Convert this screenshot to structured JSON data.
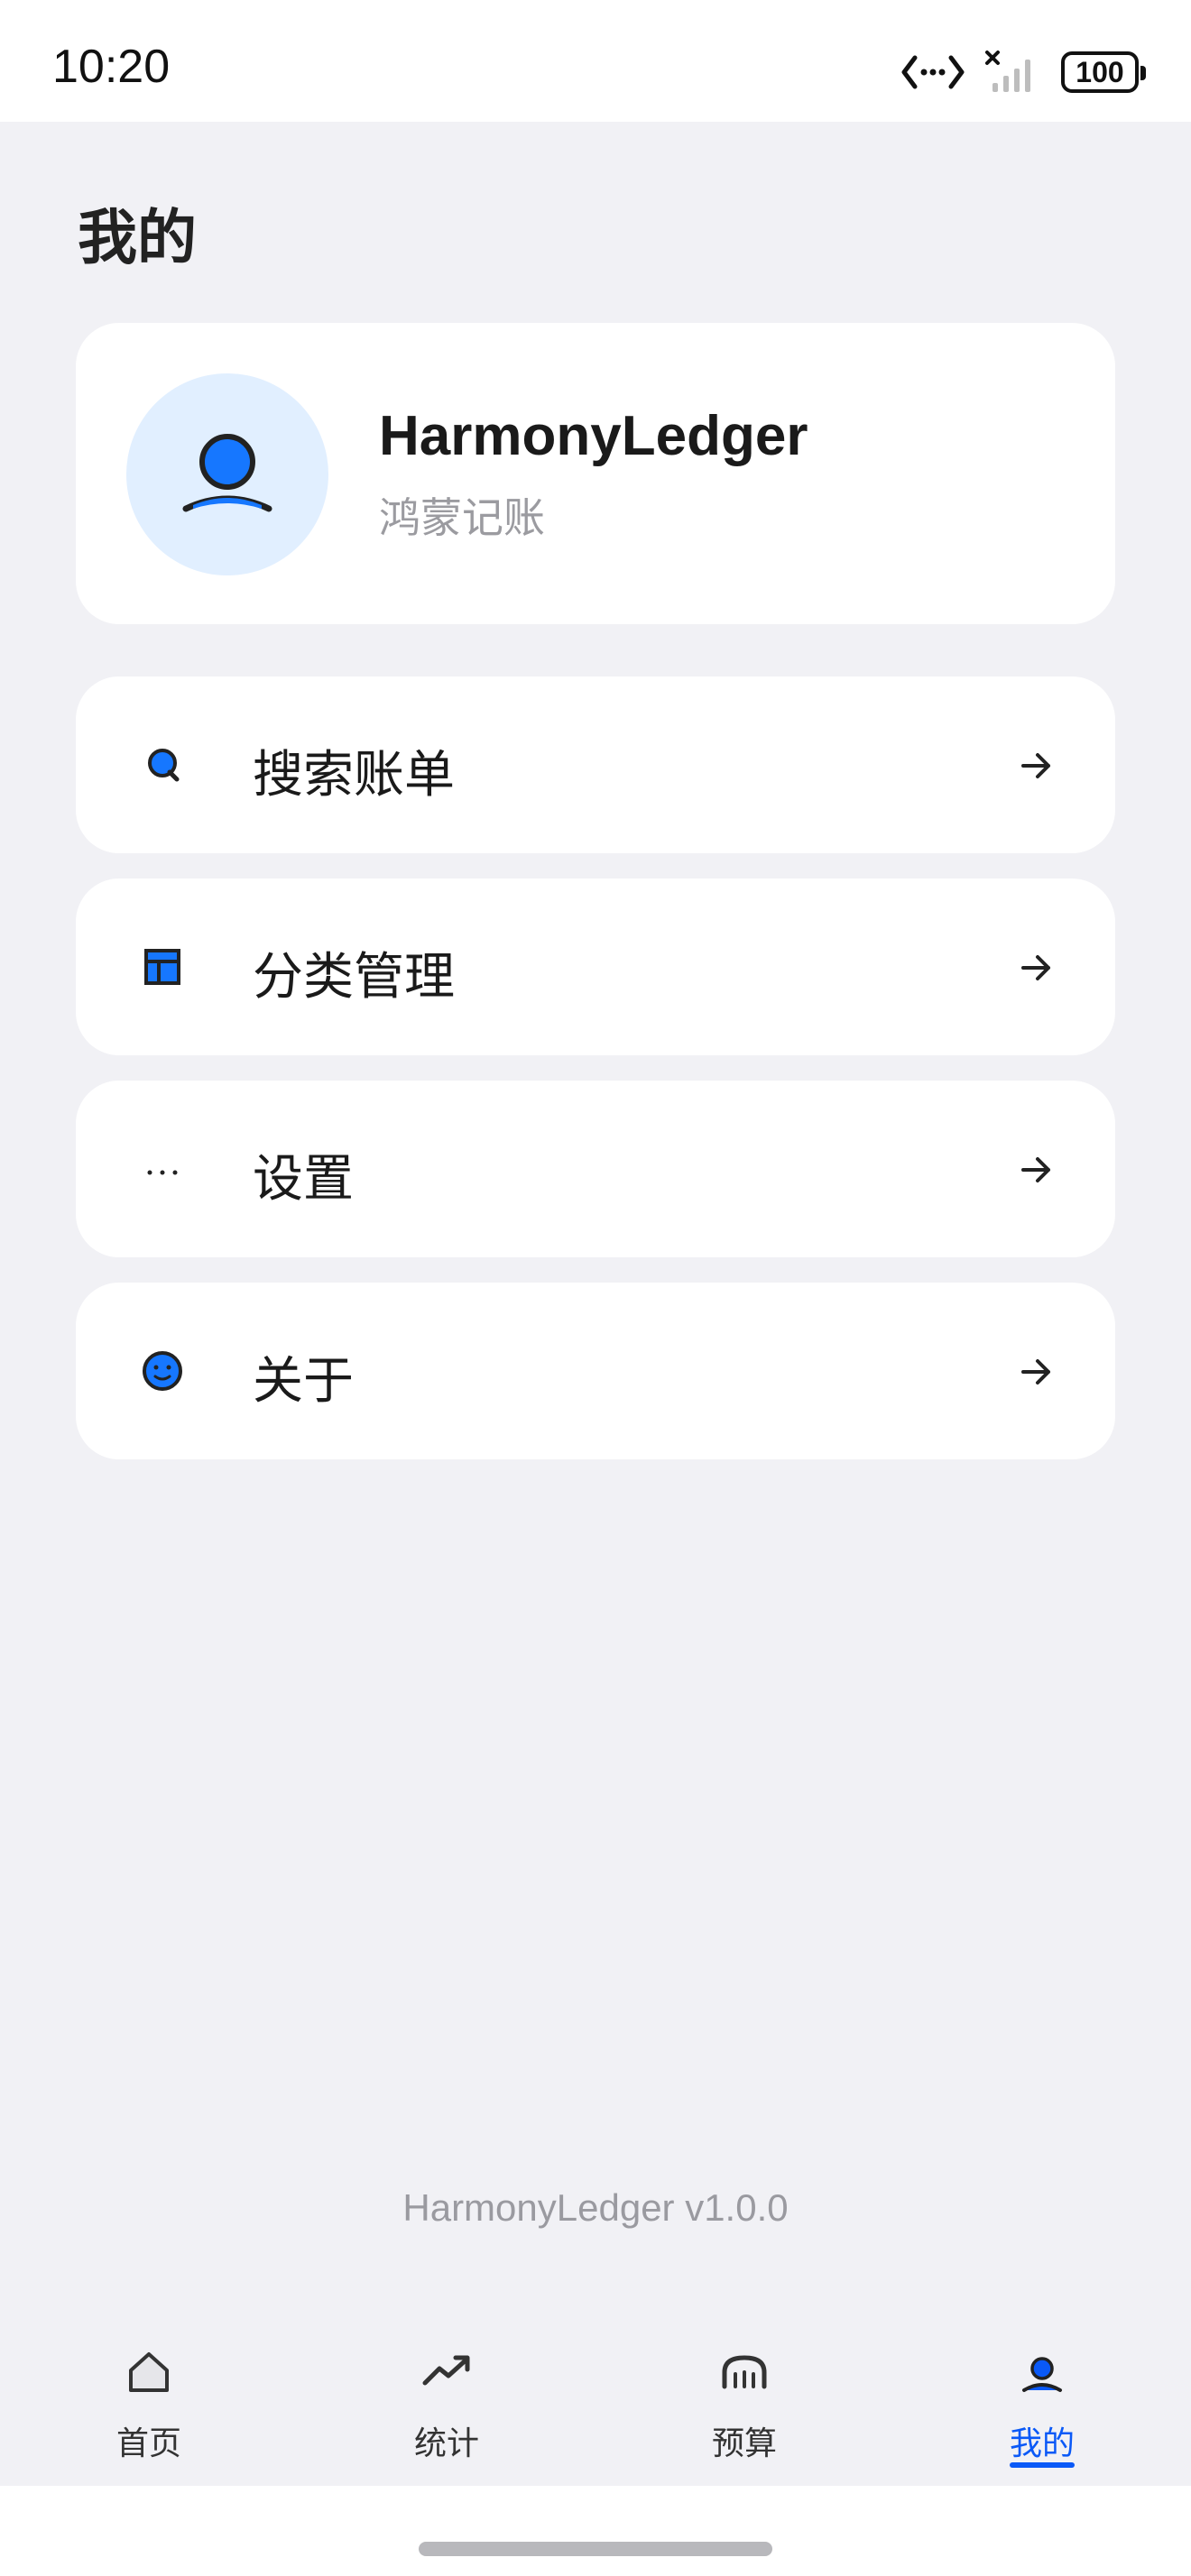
{
  "status_bar": {
    "time": "10:20",
    "battery": "100",
    "icons": [
      "data-transfer-icon",
      "no-signal-icon",
      "battery-icon"
    ]
  },
  "page": {
    "title": "我的"
  },
  "profile": {
    "name": "HarmonyLedger",
    "subtitle": "鸿蒙记账",
    "avatar_icon": "person-icon",
    "avatar_bg": "#e1efff"
  },
  "menu": [
    {
      "label": "搜索账单",
      "icon": "search-icon"
    },
    {
      "label": "分类管理",
      "icon": "category-grid-icon"
    },
    {
      "label": "设置",
      "icon": "more-dots-icon"
    },
    {
      "label": "关于",
      "icon": "smiley-icon"
    }
  ],
  "footer": {
    "version": "HarmonyLedger v1.0.0"
  },
  "tab_bar": {
    "tabs": [
      {
        "label": "首页",
        "icon": "home-icon"
      },
      {
        "label": "统计",
        "icon": "trend-icon"
      },
      {
        "label": "预算",
        "icon": "budget-icon"
      },
      {
        "label": "我的",
        "icon": "person-icon"
      }
    ],
    "active_index": 3
  },
  "colors": {
    "accent": "#0a59f7",
    "icon_blue": "#1677ff",
    "background": "#f1f1f5",
    "card": "#ffffff"
  }
}
